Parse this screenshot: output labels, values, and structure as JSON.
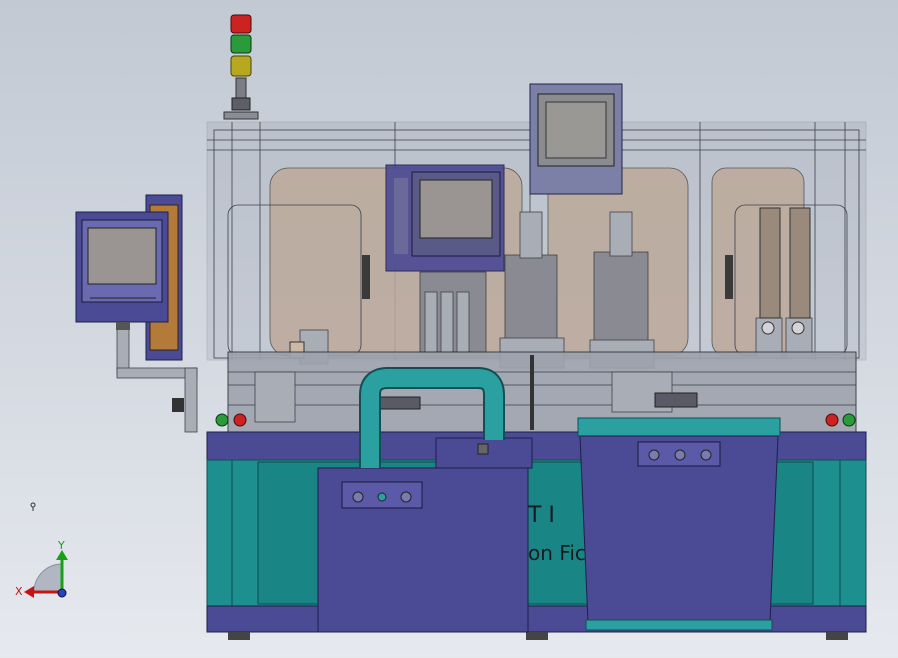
{
  "colors": {
    "background_top": "#c2c9d3",
    "frame_teal": "#1e8f8f",
    "panel_navy": "#4a4a95",
    "signal_red": "#cc2222",
    "signal_green": "#2a9a3a",
    "signal_yellow": "#b8a820",
    "axis_x": "#c41414",
    "axis_y": "#18a018",
    "axis_origin": "#2244cc"
  },
  "model": {
    "watermark_line1": "T I",
    "watermark_line2": "on Fictio"
  },
  "triad": {
    "x_label": "X",
    "y_label": "Y"
  },
  "icons": {
    "signal_tower": "signal-tower-icon",
    "hmi": "monitor-icon",
    "triad": "coordinate-triad-icon"
  }
}
